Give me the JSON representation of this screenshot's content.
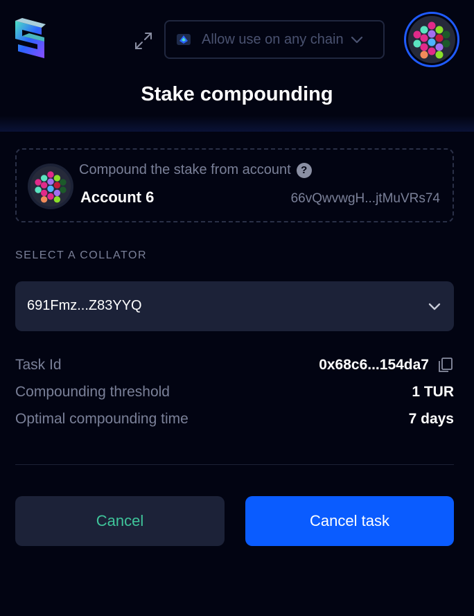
{
  "header": {
    "logo_icon": "subwallet-logo",
    "expand_icon": "expand-icon",
    "chain_selector": {
      "label": "Allow use on any chain",
      "icon": "network-icon",
      "chevron": "chevron-down-icon"
    },
    "account_avatar_icon": "identicon"
  },
  "page": {
    "title": "Stake compounding"
  },
  "account_card": {
    "hint": "Compound the stake from account",
    "help_icon": "?",
    "name": "Account 6",
    "address": "66vQwvwgH...jtMuVRs74"
  },
  "collator": {
    "section_label": "SELECT A COLLATOR",
    "value": "691Fmz...Z83YYQ"
  },
  "details": {
    "task_id_label": "Task Id",
    "task_id_value": "0x68c6...154da7",
    "threshold_label": "Compounding threshold",
    "threshold_value": "1 TUR",
    "time_label": "Optimal compounding time",
    "time_value": "7 days"
  },
  "actions": {
    "cancel_label": "Cancel",
    "cancel_task_label": "Cancel task"
  },
  "colors": {
    "background": "#020412",
    "primary": "#0a5cff",
    "accent_green": "#3fc49a",
    "muted_text": "#7a8098",
    "panel": "#1c2238"
  }
}
